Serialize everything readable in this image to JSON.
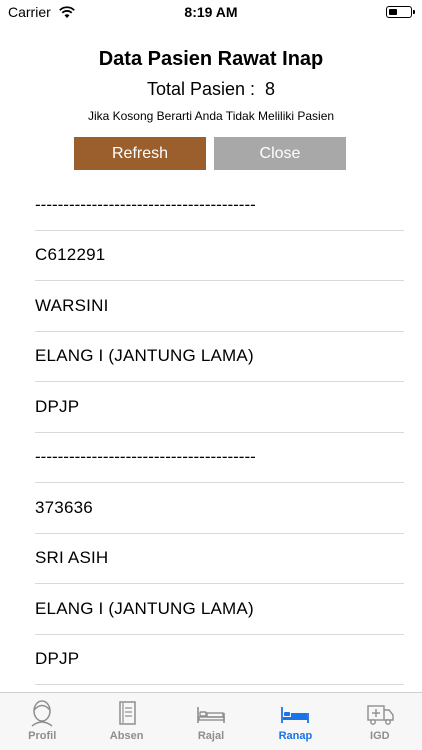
{
  "status_bar": {
    "carrier": "Carrier",
    "time": "8:19 AM"
  },
  "header": {
    "title": "Data Pasien Rawat Inap",
    "total_label": "Total Pasien :",
    "total_value": "8",
    "hint": "Jika Kosong Berarti Anda Tidak Meliliki Pasien"
  },
  "buttons": {
    "refresh": "Refresh",
    "close": "Close"
  },
  "list": {
    "rows": [
      "---------------------------------------",
      "C612291",
      "WARSINI",
      "ELANG I (JANTUNG LAMA)",
      "DPJP",
      "---------------------------------------",
      "373636",
      "SRI ASIH",
      "ELANG I (JANTUNG LAMA)",
      "DPJP"
    ]
  },
  "tabbar": {
    "tabs": [
      {
        "label": "Profil",
        "icon": "profile-icon"
      },
      {
        "label": "Absen",
        "icon": "notebook-icon"
      },
      {
        "label": "Rajal",
        "icon": "bed-icon"
      },
      {
        "label": "Ranap",
        "icon": "bed-icon"
      },
      {
        "label": "IGD",
        "icon": "ambulance-icon"
      }
    ],
    "active_index": 3,
    "active_color": "#1a73e8",
    "inactive_color": "#8e8e8e"
  },
  "colors": {
    "refresh_button": "#9a5f2d",
    "close_button": "#a8a8a8"
  }
}
